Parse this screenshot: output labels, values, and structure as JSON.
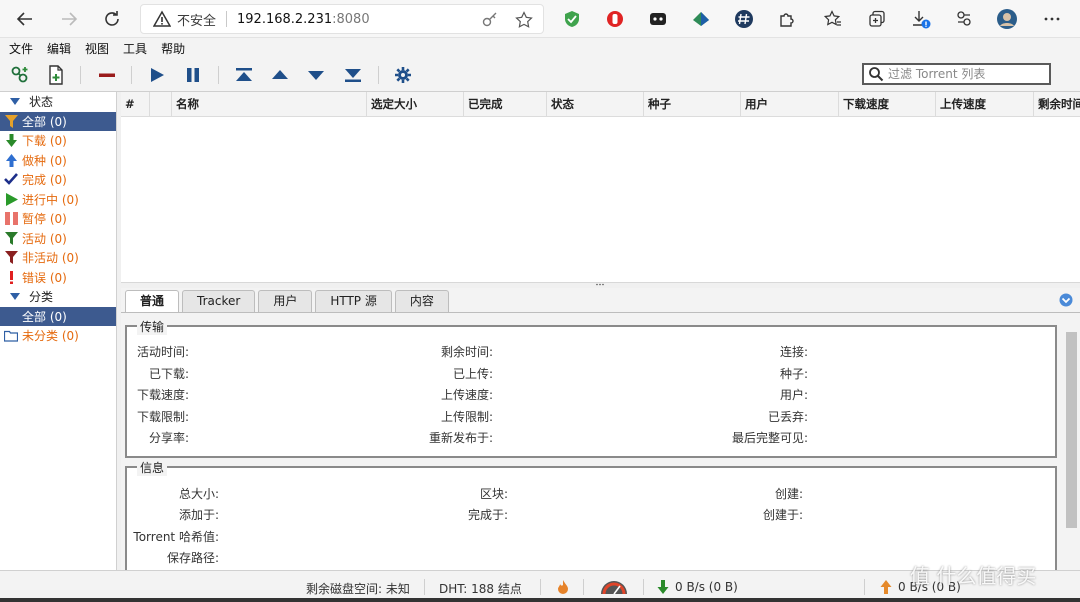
{
  "browser": {
    "insecure_label": "不安全",
    "url_host": "192.168.2.231",
    "url_port": ":8080"
  },
  "menu": [
    "文件",
    "编辑",
    "视图",
    "工具",
    "帮助"
  ],
  "toolbar": {
    "filter_placeholder": "过滤 Torrent 列表"
  },
  "sidebar": {
    "status_header": "状态",
    "status_items": [
      {
        "label": "全部 (0)",
        "icon": "filter-icon",
        "color": "#e56a0e"
      },
      {
        "label": "下载 (0)",
        "icon": "download-arrow-icon",
        "color": "#2a8a2a"
      },
      {
        "label": "做种 (0)",
        "icon": "upload-arrow-icon",
        "color": "#2f6fd0"
      },
      {
        "label": "完成 (0)",
        "icon": "checkmark-icon",
        "color": "#1d2f8a"
      },
      {
        "label": "进行中 (0)",
        "icon": "play-icon",
        "color": "#2a9a2a"
      },
      {
        "label": "暂停 (0)",
        "icon": "pause-icon",
        "color": "#e8736b"
      },
      {
        "label": "活动 (0)",
        "icon": "filter-icon",
        "color": "#2a7a2a"
      },
      {
        "label": "非活动 (0)",
        "icon": "filter-icon",
        "color": "#8a2020"
      },
      {
        "label": "错误 (0)",
        "icon": "exclamation-icon",
        "color": "#e02020"
      }
    ],
    "category_header": "分类",
    "category_items": [
      {
        "label": "全部 (0)"
      },
      {
        "label": "未分类 (0)"
      }
    ]
  },
  "table": {
    "columns": [
      "#",
      "",
      "名称",
      "选定大小",
      "已完成",
      "状态",
      "种子",
      "用户",
      "下载速度",
      "上传速度",
      "剩余时间"
    ]
  },
  "details": {
    "tabs": [
      "普通",
      "Tracker",
      "用户",
      "HTTP 源",
      "内容"
    ],
    "transfer": {
      "legend": "传输",
      "col1": [
        "活动时间:",
        "已下载:",
        "下载速度:",
        "下载限制:",
        "分享率:"
      ],
      "col2": [
        "剩余时间:",
        "已上传:",
        "上传速度:",
        "上传限制:",
        "重新发布于:"
      ],
      "col3": [
        "连接:",
        "种子:",
        "用户:",
        "已丢弃:",
        "最后完整可见:"
      ]
    },
    "info": {
      "legend": "信息",
      "col1": [
        "总大小:",
        "添加于:",
        "Torrent 哈希值:",
        "保存路径:"
      ],
      "col2": [
        "区块:",
        "完成于:"
      ],
      "col3": [
        "创建:",
        "创建于:"
      ]
    }
  },
  "status": {
    "free_space": "剩余磁盘空间: 未知",
    "dht": "DHT: 188 结点",
    "download": "0 B/s (0 B)",
    "upload": "0 B/s (0 B)"
  },
  "watermark": "值 什么值得买"
}
